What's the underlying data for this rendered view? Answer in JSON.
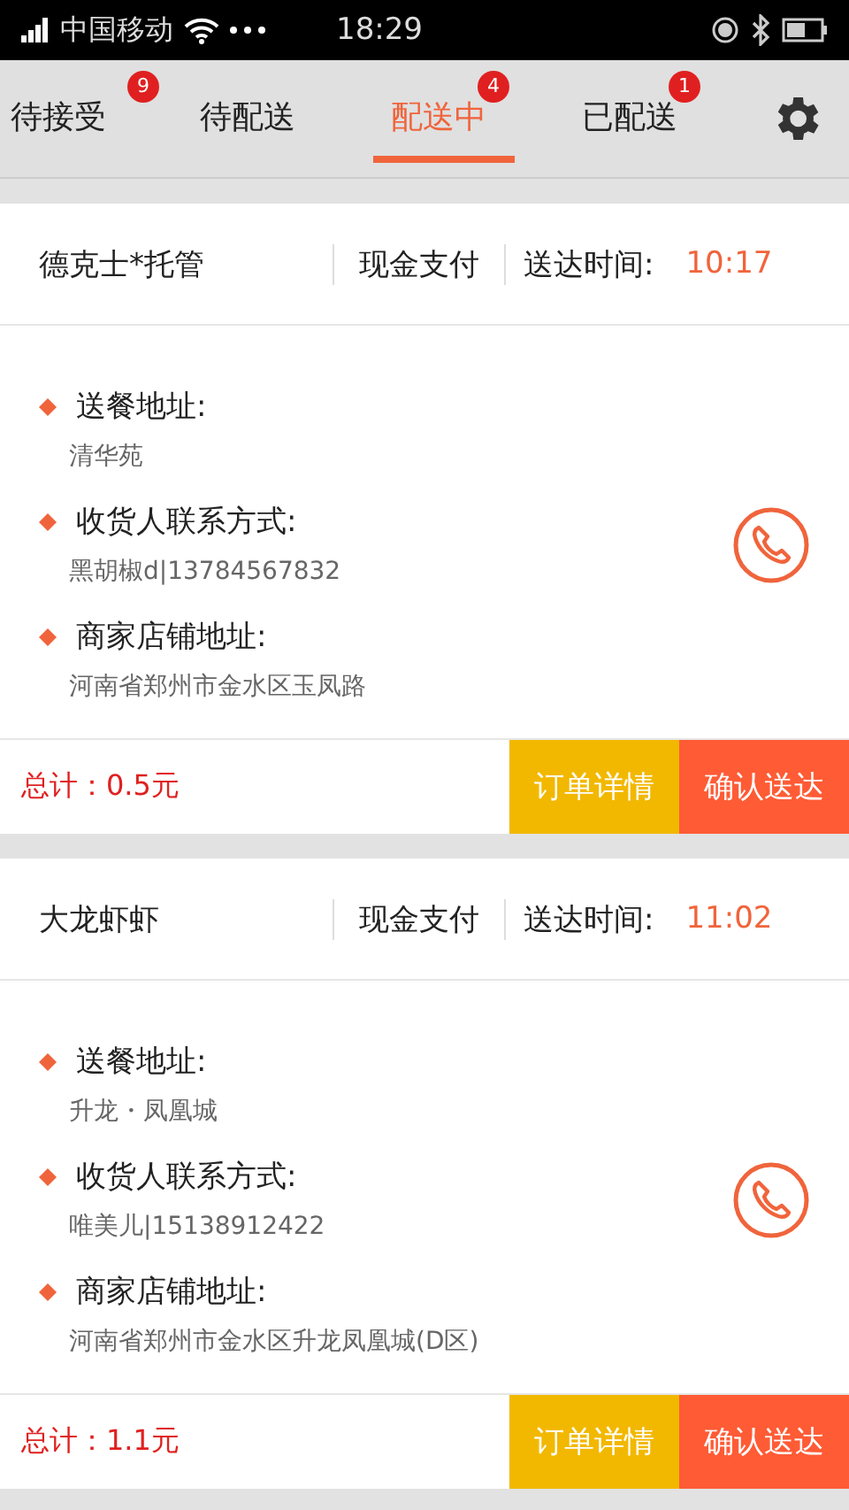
{
  "status_bar": {
    "carrier": "中国移动",
    "time": "18:29"
  },
  "tabs": [
    {
      "label": "待接受",
      "badge": "9",
      "selected": false
    },
    {
      "label": "待配送",
      "selected": false
    },
    {
      "label": "配送中",
      "badge": "4",
      "selected": true
    },
    {
      "label": "已配送",
      "badge": "1",
      "selected": false
    }
  ],
  "orders": [
    {
      "shop": "德克士*托管",
      "payment": "现金支付",
      "time_label": "送达时间:",
      "time": "10:17",
      "fields": [
        {
          "label": "送餐地址:",
          "value": "清华苑"
        },
        {
          "label": "收货人联系方式:",
          "value": "黑胡椒d|13784567832"
        },
        {
          "label": "商家店铺地址:",
          "value": "河南省郑州市金水区玉凤路"
        }
      ],
      "total": "总计：0.5元",
      "buttons": [
        "订单详情",
        "确认送达"
      ]
    },
    {
      "shop": "大龙虾虾",
      "payment": "现金支付",
      "time_label": "送达时间:",
      "time": "11:02",
      "fields": [
        {
          "label": "送餐地址:",
          "value": "升龙・凤凰城"
        },
        {
          "label": "收货人联系方式:",
          "value": "唯美儿|15138912422"
        },
        {
          "label": "商家店铺地址:",
          "value": "河南省郑州市金水区升龙凤凰城(D区)"
        }
      ],
      "total": "总计：1.1元",
      "buttons": [
        "订单详情",
        "确认送达"
      ]
    }
  ]
}
